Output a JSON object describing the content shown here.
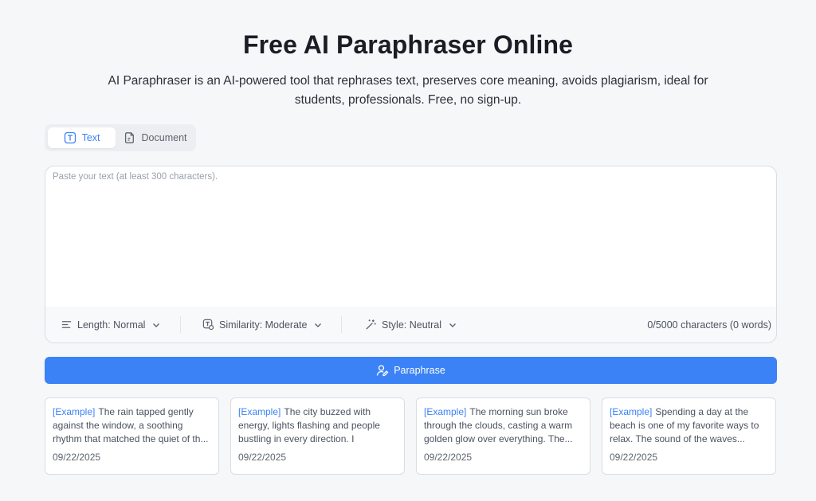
{
  "header": {
    "title": "Free AI Paraphraser Online",
    "subtitle": "AI Paraphraser is an AI-powered tool that rephrases text, preserves core meaning, avoids plagiarism, ideal for students, professionals. Free, no sign-up."
  },
  "mode_tabs": [
    {
      "label": "Text",
      "icon": "text-icon",
      "active": true
    },
    {
      "label": "Document",
      "icon": "document-icon",
      "active": false
    }
  ],
  "editor": {
    "value": "",
    "placeholder": "Paste your text (at least 300 characters).",
    "length_label": "Length: Normal",
    "similarity_label": "Similarity: Moderate",
    "style_label": "Style: Neutral",
    "counter": "0/5000 characters (0 words)"
  },
  "actions": {
    "paraphrase_label": "Paraphrase"
  },
  "examples": [
    {
      "tag": "[Example]",
      "text": "The rain tapped gently against the window, a soothing rhythm that matched the quiet of th...",
      "date": "09/22/2025"
    },
    {
      "tag": "[Example]",
      "text": "The city buzzed with energy, lights flashing and people bustling in every direction. I weaved...",
      "date": "09/22/2025"
    },
    {
      "tag": "[Example]",
      "text": "The morning sun broke through the clouds, casting a warm golden glow over everything. The...",
      "date": "09/22/2025"
    },
    {
      "tag": "[Example]",
      "text": "Spending a day at the beach is one of my favorite ways to relax. The sound of the waves...",
      "date": "09/22/2025"
    }
  ],
  "colors": {
    "accent": "#3b82f6",
    "background": "#f6f7f9",
    "title": "#1a1d24"
  }
}
